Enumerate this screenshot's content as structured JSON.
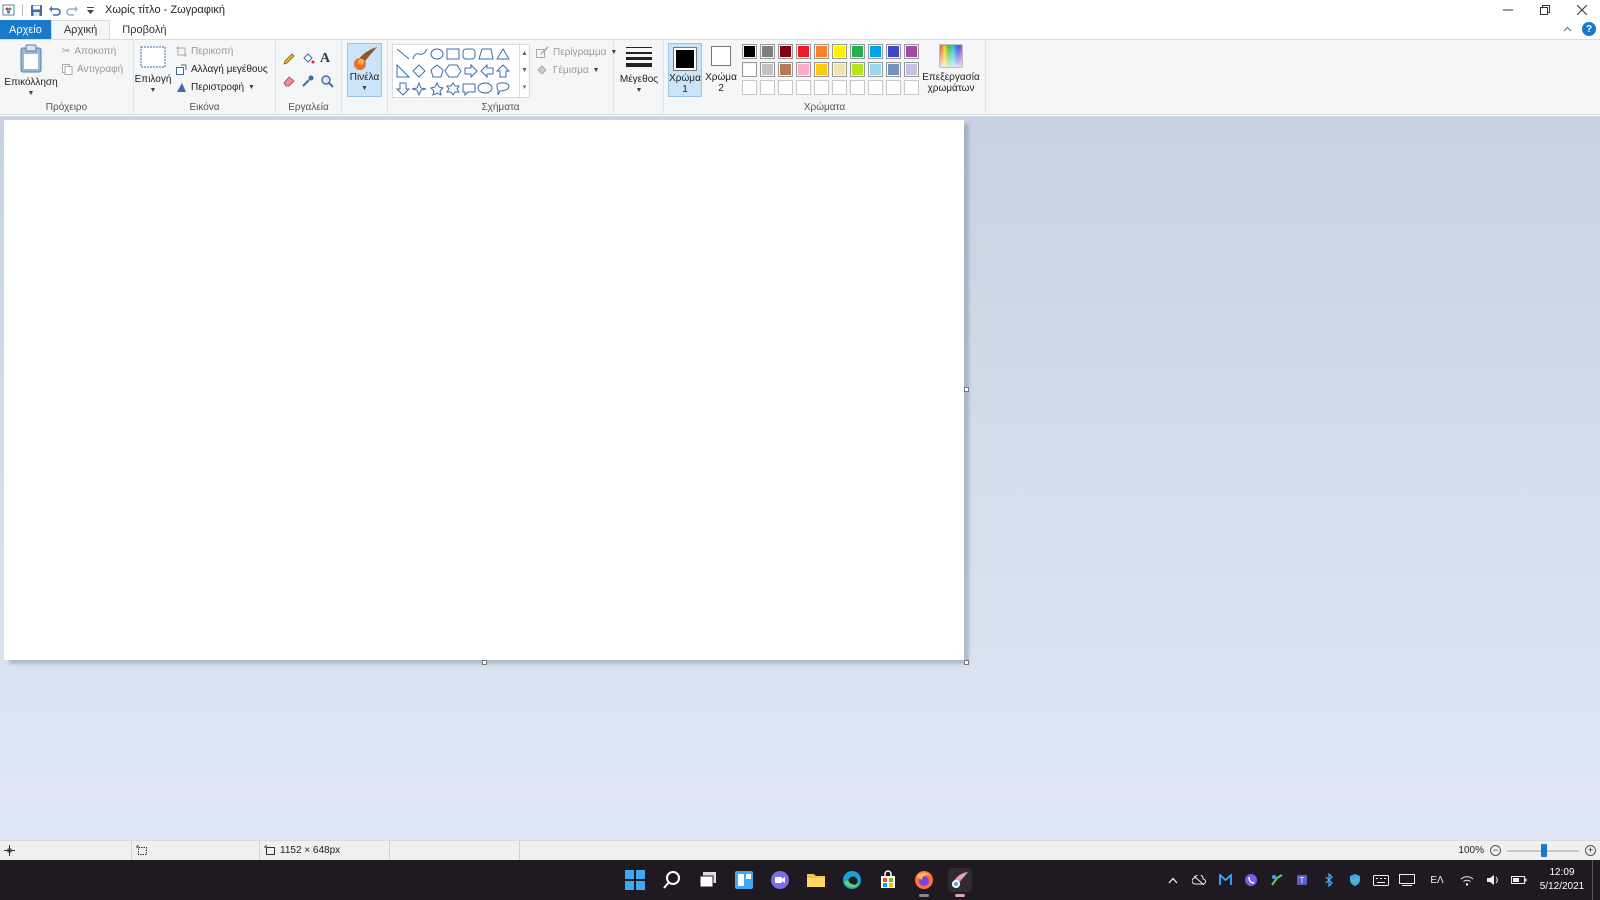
{
  "window": {
    "title": "Χωρίς τίτλο - Ζωγραφική"
  },
  "tabs": {
    "file": "Αρχείο",
    "home": "Αρχική",
    "view": "Προβολή"
  },
  "clipboard": {
    "label": "Πρόχειρο",
    "paste": "Επικόλληση",
    "cut": "Αποκοπή",
    "copy": "Αντιγραφή"
  },
  "image": {
    "label": "Εικόνα",
    "select": "Επιλογή",
    "crop": "Περικοπή",
    "resize": "Αλλαγή μεγέθους",
    "rotate": "Περιστροφή"
  },
  "tools": {
    "label": "Εργαλεία"
  },
  "brushes": {
    "label": "Πινέλα"
  },
  "shapes": {
    "label": "Σχήματα",
    "outline": "Περίγραμμα",
    "fill": "Γέμισμα"
  },
  "size": {
    "label": "Μέγεθος"
  },
  "colors": {
    "label": "Χρώματα",
    "color1_line1": "Χρώμα",
    "color1_line2": "1",
    "color2_line1": "Χρώμα",
    "color2_line2": "2",
    "edit_line1": "Επεξεργασία",
    "edit_line2": "χρωμάτων",
    "color1_value": "#000000",
    "color2_value": "#ffffff",
    "palette_row1": [
      "#000000",
      "#7f7f7f",
      "#880015",
      "#ed1c24",
      "#ff7f27",
      "#fff200",
      "#22b14c",
      "#00a2e8",
      "#3f48cc",
      "#a349a4"
    ],
    "palette_row2": [
      "#ffffff",
      "#c3c3c3",
      "#b97a57",
      "#ffaec9",
      "#ffc90e",
      "#efe4b0",
      "#b5e61d",
      "#99d9ea",
      "#7092be",
      "#c8bfe7"
    ]
  },
  "status": {
    "image_size": "1152 × 648px",
    "zoom": "100%"
  },
  "taskbar": {
    "language": "ΕΛ",
    "time": "12:09",
    "date": "5/12/2021"
  }
}
